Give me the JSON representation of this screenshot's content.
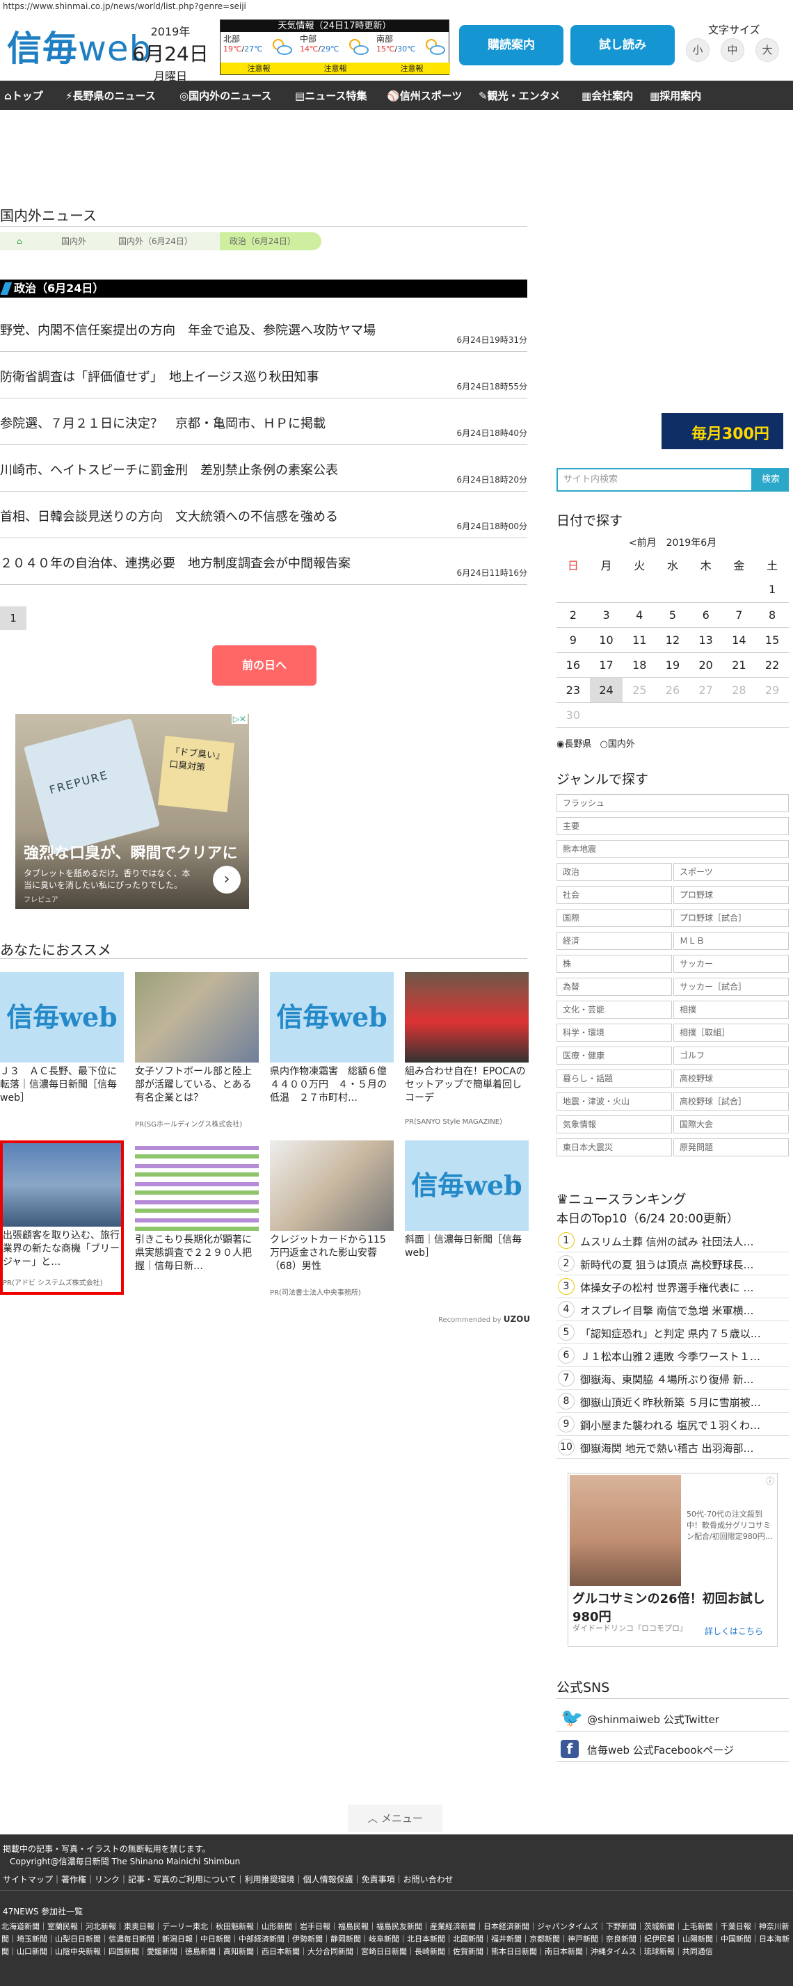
{
  "url": "https://www.shinmai.co.jp/news/world/list.php?genre=seiji",
  "logo": {
    "main": "信毎",
    "sub": "web"
  },
  "date": {
    "year": "2019年",
    "md": "6月24日",
    "weekday": "月曜日"
  },
  "weather": {
    "header": "天気情報（24日17時更新）",
    "regions": [
      {
        "name": "北部",
        "hi": "19℃",
        "lo": "27℃",
        "alert": "注意報"
      },
      {
        "name": "中部",
        "hi": "14℃",
        "lo": "29℃",
        "alert": "注意報"
      },
      {
        "name": "南部",
        "hi": "15℃",
        "lo": "30℃",
        "alert": "注意報"
      }
    ]
  },
  "buttons": {
    "subscribe": "購読案内",
    "trial": "試し読み"
  },
  "fontsize": {
    "label": "文字サイズ",
    "small": "小",
    "mid": "中",
    "large": "大"
  },
  "nav": [
    "トップ",
    "長野県のニュース",
    "国内外のニュース",
    "ニュース特集",
    "信州スポーツ",
    "観光・エンタメ",
    "会社案内",
    "採用案内"
  ],
  "section": {
    "title": "国内外ニュース",
    "crumbs": [
      "国内外",
      "国内外（6月24日）",
      "政治（6月24日）"
    ],
    "category": "政治（6月24日）"
  },
  "news": [
    {
      "h": "野党、内閣不信任案提出の方向　年金で追及、参院選へ攻防ヤマ場",
      "t": "6月24日19時31分"
    },
    {
      "h": "防衛省調査は「評価値せず」　地上イージス巡り秋田知事",
      "t": "6月24日18時55分"
    },
    {
      "h": "参院選、７月２１日に決定？　京都・亀岡市、ＨＰに掲載",
      "t": "6月24日18時40分"
    },
    {
      "h": "川崎市、ヘイトスピーチに罰金刑　差別禁止条例の素案公表",
      "t": "6月24日18時20分"
    },
    {
      "h": "首相、日韓会談見送りの方向　文大統領への不信感を強める",
      "t": "6月24日18時00分"
    },
    {
      "h": "２０４０年の自治体、連携必要　地方制度調査会が中間報告案",
      "t": "6月24日11時16分"
    }
  ],
  "pager": "1",
  "prevday": "前の日へ",
  "ad1": {
    "pack": "FREPURE",
    "note": "『ドブ臭い』口臭対策",
    "headline": "強烈な口臭が、瞬間でクリアに",
    "sub": "タブレットを舐めるだけ。香りではなく、本当に臭いを消したい私にぴったりでした。",
    "src": "フレピュア"
  },
  "rec": {
    "title": "あなたにおススメ",
    "items": [
      {
        "img": "信毎web",
        "t": "Ｊ３　ＡＣ長野、最下位に転落｜信濃毎日新聞［信毎web］",
        "pr": ""
      },
      {
        "img": "",
        "t": "女子ソフトボール部と陸上部が活躍している、とある有名企業とは？",
        "pr": "PR(SGホールディングス株式会社)"
      },
      {
        "img": "信毎web",
        "t": "県内作物凍霜害　総額６億４４００万円　４・５月の低温　２７市町村…",
        "pr": ""
      },
      {
        "img": "",
        "t": "組み合わせ自在！EPOCAのセットアップで簡単着回しコーデ",
        "pr": "PR(SANYO Style MAGAZINE)"
      },
      {
        "img": "",
        "t": "出張顧客を取り込む、旅行業界の新たな商機「ブリージャー」と…",
        "pr": "PR(アドビ システムズ株式会社)"
      },
      {
        "img": "",
        "t": "引きこもり長期化が顕著に　県実態調査で２２９０人把握｜信毎日新…",
        "pr": ""
      },
      {
        "img": "",
        "t": "クレジットカードから115万円返金された影山安蓉（68）男性",
        "pr": "PR(司法書士法人中央事務所)"
      },
      {
        "img": "信毎web",
        "t": "斜面｜信濃毎日新聞［信毎web］",
        "pr": ""
      }
    ],
    "by": "Recommended by",
    "brand": "UZOU"
  },
  "rbanner": {
    "text": "毎月300円"
  },
  "search": {
    "placeholder": "サイト内検索",
    "button": "検索"
  },
  "calendar": {
    "title": "日付で探す",
    "nav": "<前月　2019年6月",
    "days": [
      "日",
      "月",
      "火",
      "水",
      "木",
      "金",
      "土"
    ],
    "rows": [
      [
        "",
        "",
        "",
        "",
        "",
        "",
        "1"
      ],
      [
        "2",
        "3",
        "4",
        "5",
        "6",
        "7",
        "8"
      ],
      [
        "9",
        "10",
        "11",
        "12",
        "13",
        "14",
        "15"
      ],
      [
        "16",
        "17",
        "18",
        "19",
        "20",
        "21",
        "22"
      ],
      [
        "23",
        "24",
        "25",
        "26",
        "27",
        "28",
        "29"
      ],
      [
        "30",
        "",
        "",
        "",
        "",
        "",
        ""
      ]
    ],
    "opt1": "長野県",
    "opt2": "国内外"
  },
  "genre": {
    "title": "ジャンルで探す",
    "full": [
      "フラッシュ",
      "主要",
      "熊本地震"
    ],
    "pairs": [
      [
        "政治",
        "スポーツ"
      ],
      [
        "社会",
        "プロ野球"
      ],
      [
        "国際",
        "プロ野球［試合］"
      ],
      [
        "経済",
        "ＭＬＢ"
      ],
      [
        "株",
        "サッカー"
      ],
      [
        "為替",
        "サッカー［試合］"
      ],
      [
        "文化・芸能",
        "相撲"
      ],
      [
        "科学・環境",
        "相撲［取組］"
      ],
      [
        "医療・健康",
        "ゴルフ"
      ],
      [
        "暮らし・話題",
        "高校野球"
      ],
      [
        "地震・津波・火山",
        "高校野球［試合］"
      ],
      [
        "気象情報",
        "国際大会"
      ],
      [
        "東日本大震災",
        "原発問題"
      ]
    ]
  },
  "ranking": {
    "title": "ニュースランキング",
    "sub": "本日のTop10（6/24 20:00更新）",
    "items": [
      "ムスリム土葬 信州の試み 社団法人…",
      "新時代の夏 狙うは頂点 高校野球長…",
      "体操女子の松村 世界選手権代表に …",
      "オスプレイ目撃 南信で急増 米軍横…",
      "「認知症恐れ」と判定 県内７５歳以…",
      "Ｊ１松本山雅２連敗 今季ワースト１…",
      "御嶽海、東関脇 ４場所ぶり復帰 新…",
      "御嶽山頂近く昨秋新築 ５月に雪崩被…",
      "鋼小屋また襲われる 塩尻で１羽くわ…",
      "御嶽海関 地元で熱い稽古 出羽海部…"
    ]
  },
  "ad2": {
    "note": "50代-70代の注文殺到中！軟骨成分グリコサミン配合/初回限定980円…",
    "headline": "グルコサミンの26倍！初回お試し980円",
    "src": "ダイドードリンコ『ロコモプロ』",
    "link": "詳しくはこちら"
  },
  "sns": {
    "title": "公式SNS",
    "twitter": "@shinmaiweb 公式Twitter",
    "facebook": "信毎web 公式Facebookページ"
  },
  "menu": "メニュー",
  "footer": {
    "l1": "掲載中の記事・写真・イラストの無断転用を禁じます。",
    "l2": "Copyright@信濃毎日新聞 The Shinano Mainichi Shimbun",
    "links": "サイトマップ｜著作権｜リンク｜記事・写真のご利用について｜利用推奨環境｜個人情報保護｜免責事項｜お問い合わせ",
    "l3": "47NEWS 参加社一覧",
    "papers": "北海道新聞｜室蘭民報｜河北新報｜東奥日報｜デーリー東北｜秋田魁新報｜山形新聞｜岩手日報｜福島民報｜福島民友新聞｜産業経済新聞｜日本経済新聞｜ジャパンタイムズ｜下野新聞｜茨城新聞｜上毛新聞｜千葉日報｜神奈川新聞｜埼玉新聞｜山梨日日新聞｜信濃毎日新聞｜新潟日報｜中日新聞｜中部経済新聞｜伊勢新聞｜静岡新聞｜岐阜新聞｜北日本新聞｜北國新聞｜福井新聞｜京都新聞｜神戸新聞｜奈良新聞｜紀伊民報｜山陽新聞｜中国新聞｜日本海新聞｜山口新聞｜山陰中央新報｜四国新聞｜愛媛新聞｜徳島新聞｜高知新聞｜西日本新聞｜大分合同新聞｜宮崎日日新聞｜長崎新聞｜佐賀新聞｜熊本日日新聞｜南日本新聞｜沖縄タイムス｜琉球新報｜共同通信"
  }
}
